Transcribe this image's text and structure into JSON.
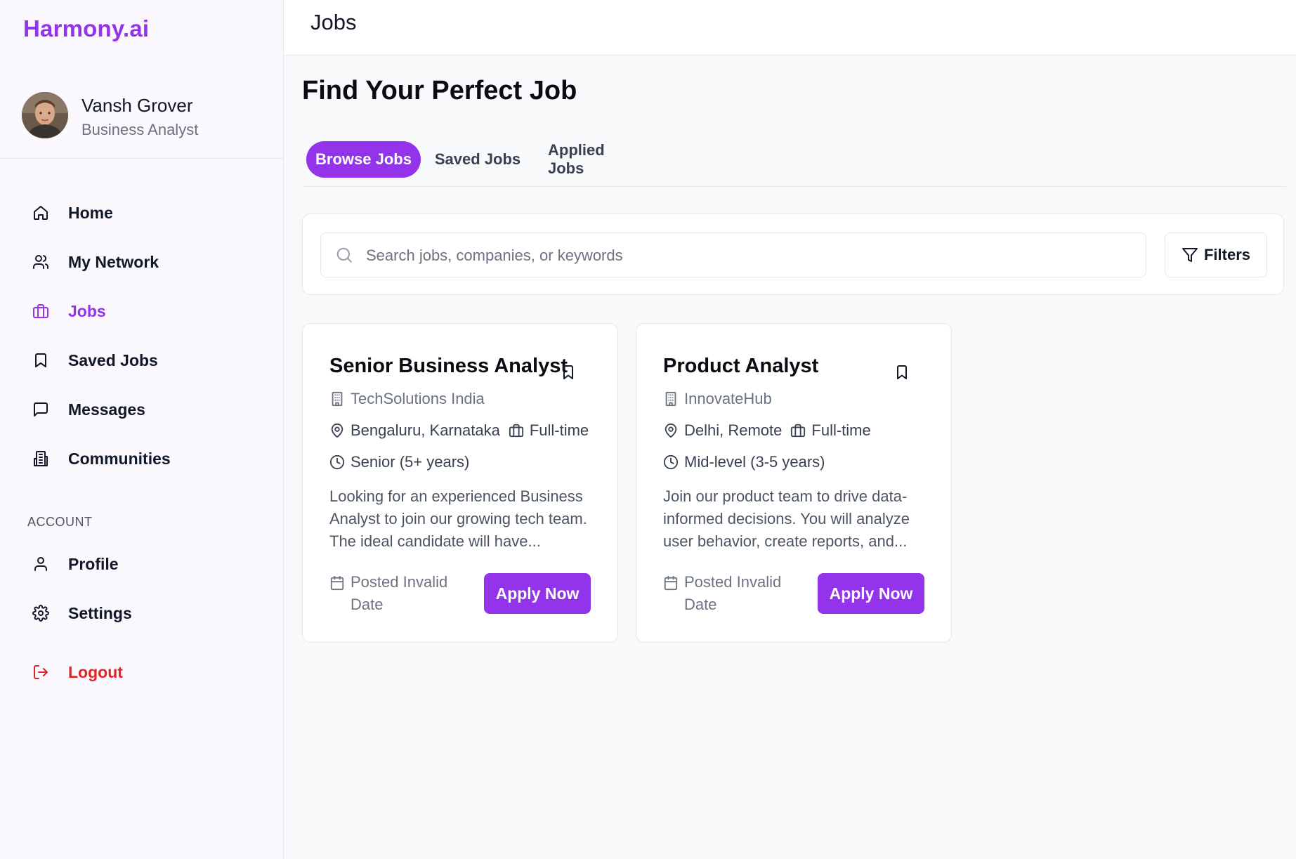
{
  "app": {
    "brand": "Harmony.ai"
  },
  "user": {
    "name": "Vansh Grover",
    "role": "Business Analyst"
  },
  "sidebar": {
    "items": [
      {
        "label": "Home",
        "icon": "home-icon"
      },
      {
        "label": "My Network",
        "icon": "users-icon"
      },
      {
        "label": "Jobs",
        "icon": "briefcase-icon",
        "active": true
      },
      {
        "label": "Saved Jobs",
        "icon": "bookmark-icon"
      },
      {
        "label": "Messages",
        "icon": "message-icon"
      },
      {
        "label": "Communities",
        "icon": "building-icon"
      }
    ],
    "account_label": "ACCOUNT",
    "account_items": [
      {
        "label": "Profile",
        "icon": "user-icon"
      },
      {
        "label": "Settings",
        "icon": "gear-icon"
      }
    ],
    "logout_label": "Logout"
  },
  "header": {
    "title": "Jobs"
  },
  "main": {
    "page_title": "Find Your Perfect Job",
    "tabs": [
      {
        "label": "Browse Jobs",
        "active": true
      },
      {
        "label": "Saved Jobs"
      },
      {
        "label": "Applied Jobs"
      }
    ],
    "search": {
      "placeholder": "Search jobs, companies, or keywords",
      "value": ""
    },
    "filters_label": "Filters"
  },
  "jobs": [
    {
      "title": "Senior Business Analyst",
      "company": "TechSolutions India",
      "location": "Bengaluru, Karnataka",
      "type": "Full-time",
      "experience": "Senior (5+ years)",
      "description": "Looking for an experienced Business Analyst to join our growing tech team. The ideal candidate will have...",
      "posted": "Posted Invalid Date",
      "apply_label": "Apply Now"
    },
    {
      "title": "Product Analyst",
      "company": "InnovateHub",
      "location": "Delhi, Remote",
      "type": "Full-time",
      "experience": "Mid-level (3-5 years)",
      "description": "Join our product team to drive data-informed decisions. You will analyze user behavior, create reports, and...",
      "posted": "Posted Invalid Date",
      "apply_label": "Apply Now"
    }
  ],
  "colors": {
    "accent": "#9333ea",
    "logout": "#dc2626",
    "background": "#f8f9fb",
    "sidebar_bg": "#faf7fd"
  }
}
